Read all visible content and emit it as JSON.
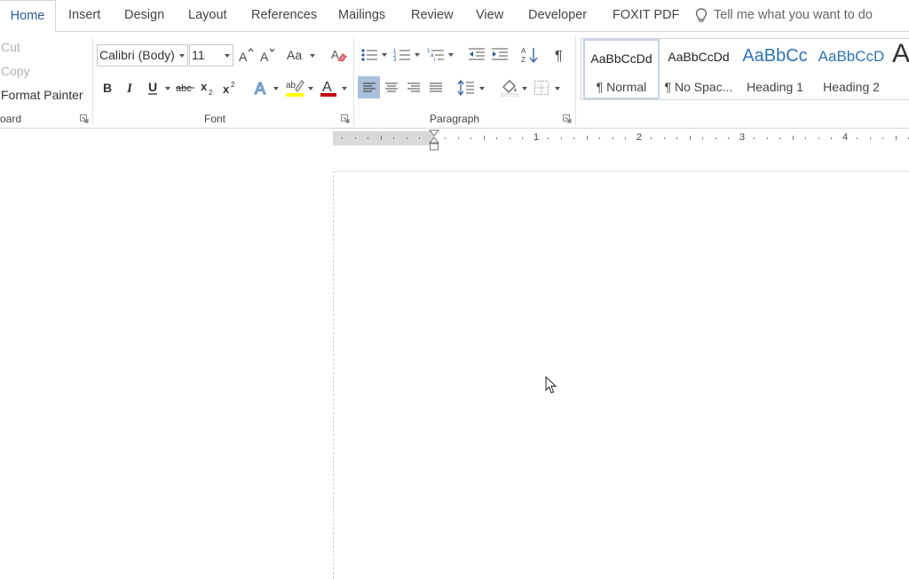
{
  "tabs": [
    "Home",
    "Insert",
    "Design",
    "Layout",
    "References",
    "Mailings",
    "Review",
    "View",
    "Developer",
    "FOXIT PDF"
  ],
  "tell_me_placeholder": "Tell me what you want to do",
  "clipboard": {
    "cut": "Cut",
    "copy": "Copy",
    "format_painter": "Format Painter",
    "group_label": "oard"
  },
  "font": {
    "family": "Calibri (Body)",
    "size": "11",
    "group_label": "Font",
    "change_case": "Aa"
  },
  "paragraph": {
    "group_label": "Paragraph"
  },
  "styles": [
    {
      "sample": "AaBbCcDd",
      "label": "¶ Normal"
    },
    {
      "sample": "AaBbCcDd",
      "label": "¶ No Spac..."
    },
    {
      "sample": "AaBbCc",
      "label": "Heading 1"
    },
    {
      "sample": "AaBbCcD",
      "label": "Heading 2"
    },
    {
      "sample": "A",
      "label": ""
    }
  ],
  "ruler_numbers": [
    "1",
    "2",
    "3",
    "4"
  ],
  "colors": {
    "accent": "#2b579a",
    "highlight": "#ffff00",
    "font_color": "#c00000",
    "heading": "#2e74b5"
  }
}
